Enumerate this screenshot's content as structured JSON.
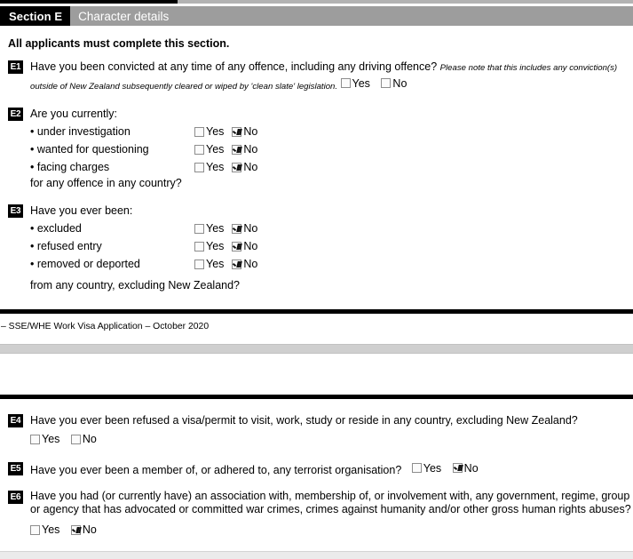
{
  "header": {
    "section_tag": "Section E",
    "section_title": "Character details"
  },
  "intro": "All applicants must complete this section.",
  "labels": {
    "yes": "Yes",
    "no": "No"
  },
  "questions": [
    {
      "tag": "E1",
      "text": "Have you been convicted at any time of any offence, including any driving offence?",
      "note": "Please note that this includes any conviction(s) outside of New Zealand subsequently cleared or wiped by 'clean slate' legislation.",
      "yes_checked": false,
      "no_checked": false
    },
    {
      "tag": "E2",
      "text": "Are you currently:",
      "tail": "for any offence in any country?",
      "bullets": [
        {
          "label": "• under investigation",
          "yes_checked": false,
          "no_checked": true
        },
        {
          "label": "• wanted for questioning",
          "yes_checked": false,
          "no_checked": true
        },
        {
          "label": "• facing charges",
          "yes_checked": false,
          "no_checked": true
        }
      ]
    },
    {
      "tag": "E3",
      "text": "Have you ever been:",
      "tail": "from any country, excluding New Zealand?",
      "bullets": [
        {
          "label": "• excluded",
          "yes_checked": false,
          "no_checked": true
        },
        {
          "label": "• refused entry",
          "yes_checked": false,
          "no_checked": true
        },
        {
          "label": "• removed or deported",
          "yes_checked": false,
          "no_checked": true
        }
      ]
    },
    {
      "tag": "E4",
      "text": "Have you ever been refused a visa/permit to visit, work, study or reside in any country, excluding New Zealand?",
      "yes_checked": false,
      "no_checked": false
    },
    {
      "tag": "E5",
      "text": "Have you ever been a member of, or adhered to, any terrorist organisation?",
      "yes_checked": false,
      "no_checked": true
    },
    {
      "tag": "E6",
      "text": "Have you had (or currently have) an association with, membership of, or involvement with, any government, regime, group or agency that has advocated or committed war crimes, crimes against humanity and/or other gross human rights abuses?",
      "yes_checked": false,
      "no_checked": true
    }
  ],
  "footer": {
    "text": "– SSE/WHE Work Visa Application – October 2020"
  },
  "colors": {
    "tag_background": "#000000",
    "title_background": "#9d9d9d",
    "rule": "#000000",
    "page_band": "#cfcfcf",
    "checkbox_border": "#8d8d8d"
  }
}
